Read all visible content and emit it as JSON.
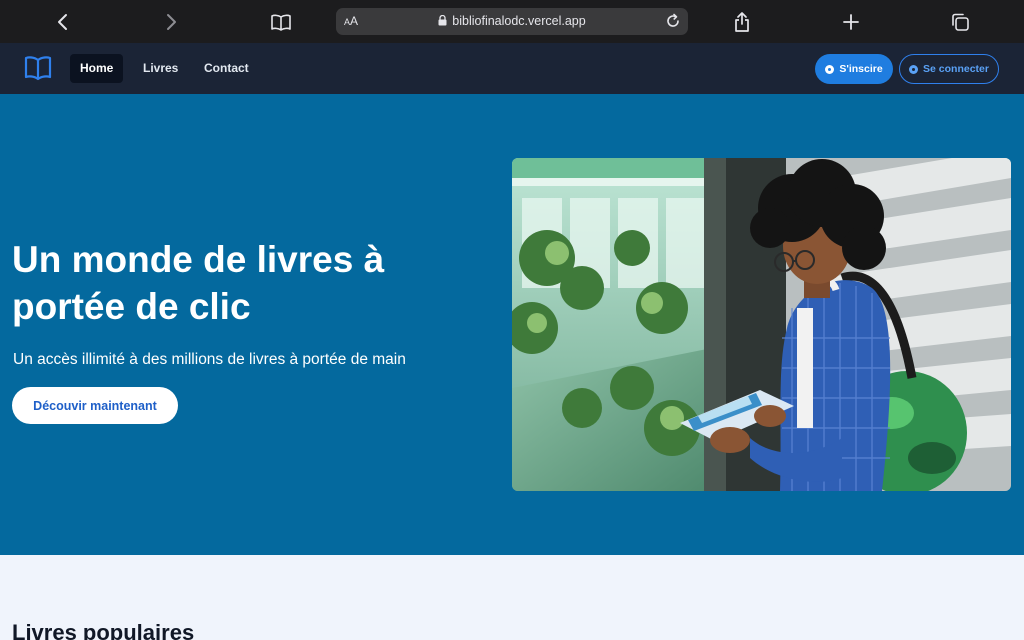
{
  "browser": {
    "aa_label_small": "A",
    "aa_label_large": "A",
    "url": "bibliofinalodc.vercel.app",
    "icons": [
      "back-icon",
      "forward-icon",
      "bookmarks-icon",
      "lock-icon",
      "reload-icon",
      "share-icon",
      "new-tab-icon",
      "tabs-overview-icon"
    ]
  },
  "nav": {
    "links": [
      {
        "label": "Home",
        "active": true
      },
      {
        "label": "Livres",
        "active": false
      },
      {
        "label": "Contact",
        "active": false
      }
    ],
    "signup_label": "S'inscire",
    "login_label": "Se connecter"
  },
  "hero": {
    "title": "Un monde de livres à portée de clic",
    "subtitle": "Un accès illimité à des millions de livres à portée de main",
    "cta_label": "Découvir maintenant"
  },
  "popular": {
    "title": "Livres populaires"
  },
  "colors": {
    "hero_bg": "#04699e",
    "nav_bg": "#1b2436",
    "primary_button": "#1f7de0",
    "page_bg": "#f0f4fc"
  }
}
